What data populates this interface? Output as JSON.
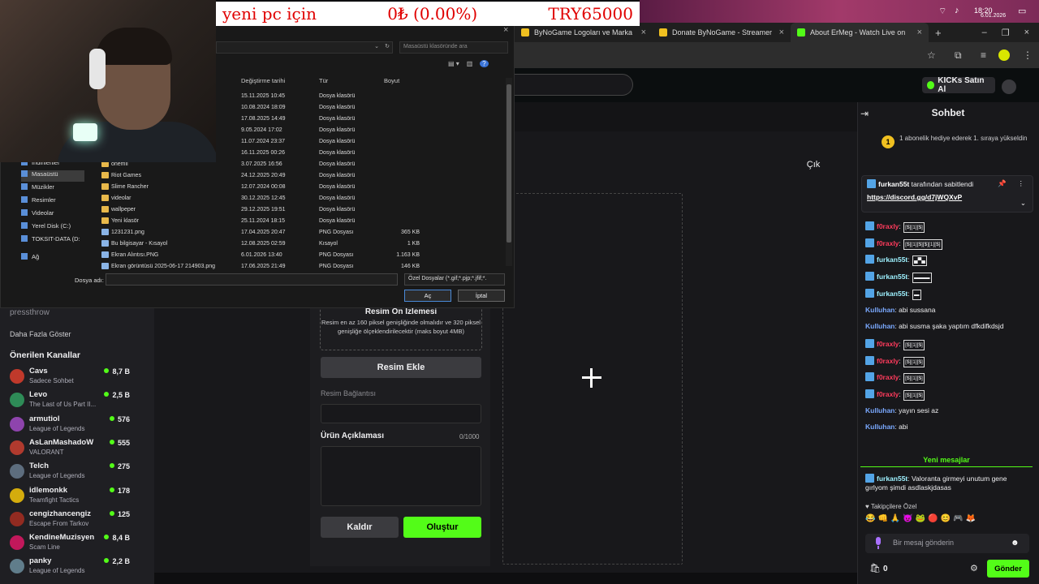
{
  "donation": {
    "left": "yeni pc için",
    "middle": "0₺ (0.00%)",
    "right": "TRY65000"
  },
  "system_tray": {
    "time": "18:20",
    "date": "6.01.2026"
  },
  "browser": {
    "tabs": [
      {
        "label": "ByNoGame Logoları ve Marka",
        "fav_color": "#f0c020"
      },
      {
        "label": "Donate ByNoGame - Streamer",
        "fav_color": "#f0c020"
      },
      {
        "label": "About ErMeg - Watch Live on",
        "fav_color": "#53fc18"
      }
    ]
  },
  "site": {
    "kicks_label": "KICKs Satın Al",
    "exit_label": "Çık"
  },
  "form": {
    "preview_title": "Resim Ön İzlemesi",
    "preview_desc": "Resim en az 160 piksel genişliğinde olmalıdır ve 320 piksel genişliğe ölçeklendirilecektir (maks boyut 4MB)",
    "add_image": "Resim Ekle",
    "link_label": "Resim Bağlantısı",
    "desc_label": "Ürün Açıklaması",
    "desc_count": "0/1000",
    "remove": "Kaldır",
    "create": "Oluştur"
  },
  "sidebar": {
    "partial_channel": "pressthrow",
    "show_more": "Daha Fazla Göster",
    "recommended_title": "Önerilen Kanallar",
    "channels": [
      {
        "name": "Cavs",
        "game": "Sadece Sohbet",
        "viewers": "8,7 B",
        "color": "#c0392b"
      },
      {
        "name": "Levo",
        "game": "The Last of Us Part II...",
        "viewers": "2,5 B",
        "color": "#2e8b57"
      },
      {
        "name": "armutiol",
        "game": "League of Legends",
        "viewers": "576",
        "color": "#8e44ad"
      },
      {
        "name": "AsLanMashadoW",
        "game": "VALORANT",
        "viewers": "555",
        "color": "#b03a2e"
      },
      {
        "name": "Telch",
        "game": "League of Legends",
        "viewers": "275",
        "color": "#5d6d7e"
      },
      {
        "name": "idlemonkk",
        "game": "Teamfight Tactics",
        "viewers": "178",
        "color": "#d4ac0d"
      },
      {
        "name": "cengizhancengiz",
        "game": "Escape From Tarkov",
        "viewers": "125",
        "color": "#922b21"
      },
      {
        "name": "KendineMuzisyen",
        "game": "Scam Line",
        "viewers": "8,4 B",
        "color": "#c2185b"
      },
      {
        "name": "panky",
        "game": "League of Legends",
        "viewers": "2,2 B",
        "color": "#607d8b"
      }
    ]
  },
  "chat": {
    "title": "Sohbet",
    "sub_badge": "1",
    "sub_text": "1 abonelik hediye ederek 1. sıraya yükseldin",
    "pinned_by": "furkan55t",
    "pinned_suffix": " tarafından sabitlendi",
    "pinned_link": "https://discord.gg/d7jWQXvP",
    "messages": [
      {
        "user": "f0raxly",
        "text": "",
        "emotes": "[$][1][$]",
        "color": "#ff3b5c"
      },
      {
        "user": "f0raxly",
        "text": "",
        "emotes": "[$][1][$][$][1][$]",
        "color": "#ff3b5c"
      },
      {
        "user": "furkan55t",
        "text": "",
        "emotes": "▄▀▄",
        "color": "#9ef1ff"
      },
      {
        "user": "furkan55t",
        "text": "",
        "emotes": "▬▬▬",
        "color": "#9ef1ff"
      },
      {
        "user": "furkan55t",
        "text": "",
        "emotes": "▬",
        "color": "#9ef1ff"
      },
      {
        "user": "Kulluhan",
        "text": "abi sussana",
        "emotes": "",
        "color": "#7aa9ff"
      },
      {
        "user": "Kulluhan",
        "text": "abi susma şaka yaptım dfkdifkdsjd",
        "emotes": "",
        "color": "#7aa9ff"
      },
      {
        "user": "f0raxly",
        "text": "",
        "emotes": "[$][1][$]",
        "color": "#ff3b5c"
      },
      {
        "user": "f0raxly",
        "text": "",
        "emotes": "[$][1][$]",
        "color": "#ff3b5c"
      },
      {
        "user": "f0raxly",
        "text": "",
        "emotes": "[$][1][$]",
        "color": "#ff3b5c"
      },
      {
        "user": "f0raxly",
        "text": "",
        "emotes": "[$][1][$]",
        "color": "#ff3b5c"
      },
      {
        "user": "Kulluhan",
        "text": "yayın sesi az",
        "emotes": "",
        "color": "#7aa9ff"
      },
      {
        "user": "Kulluhan",
        "text": "abi",
        "emotes": "",
        "color": "#7aa9ff"
      }
    ],
    "new_messages": "Yeni mesajlar",
    "last_message": {
      "user": "furkan55t",
      "text": "Valoranta girmeyi unutum gene gırlyom şimdi asdlaskjdasas",
      "color": "#9ef1ff"
    },
    "followers_only": "Takipçilere Özel",
    "input_placeholder": "Bir mesaj gönderin",
    "points": "0",
    "send": "Gönder"
  },
  "dialog": {
    "search_placeholder": "Masaüstü klasöründe ara",
    "columns": {
      "date": "Değiştirme tarihi",
      "type": "Tür",
      "size": "Boyut"
    },
    "nav": [
      {
        "label": "İndirilenler",
        "selected": false
      },
      {
        "label": "Masaüstü",
        "selected": true
      },
      {
        "label": "Müzikler",
        "selected": false
      },
      {
        "label": "Resimler",
        "selected": false
      },
      {
        "label": "Videolar",
        "selected": false
      },
      {
        "label": "Yerel Disk (C:)",
        "selected": false
      },
      {
        "label": "TOKSIT-DATA (D:",
        "selected": false
      },
      {
        "label": "Ağ",
        "selected": false
      }
    ],
    "files": [
      {
        "name": "",
        "date": "15.11.2025 10:45",
        "type": "Dosya klasörü",
        "size": "",
        "folder": true
      },
      {
        "name": "",
        "date": "10.08.2024 18:09",
        "type": "Dosya klasörü",
        "size": "",
        "folder": true
      },
      {
        "name": "",
        "date": "17.08.2025 14:49",
        "type": "Dosya klasörü",
        "size": "",
        "folder": true
      },
      {
        "name": "",
        "date": "9.05.2024 17:02",
        "type": "Dosya klasörü",
        "size": "",
        "folder": true
      },
      {
        "name": "",
        "date": "11.07.2024 23:37",
        "type": "Dosya klasörü",
        "size": "",
        "folder": true
      },
      {
        "name": "",
        "date": "16.11.2025 00:26",
        "type": "Dosya klasörü",
        "size": "",
        "folder": true
      },
      {
        "name": "önemli",
        "date": "3.07.2025 16:56",
        "type": "Dosya klasörü",
        "size": "",
        "folder": true
      },
      {
        "name": "Riot Games",
        "date": "24.12.2025 20:49",
        "type": "Dosya klasörü",
        "size": "",
        "folder": true
      },
      {
        "name": "Slime Rancher",
        "date": "12.07.2024 00:08",
        "type": "Dosya klasörü",
        "size": "",
        "folder": true
      },
      {
        "name": "videolar",
        "date": "30.12.2025 12:45",
        "type": "Dosya klasörü",
        "size": "",
        "folder": true
      },
      {
        "name": "wallpeper",
        "date": "29.12.2025 19:51",
        "type": "Dosya klasörü",
        "size": "",
        "folder": true
      },
      {
        "name": "Yeni klasör",
        "date": "25.11.2024 18:15",
        "type": "Dosya klasörü",
        "size": "",
        "folder": true
      },
      {
        "name": "1231231.png",
        "date": "17.04.2025 20:47",
        "type": "PNG Dosyası",
        "size": "365 KB",
        "folder": false
      },
      {
        "name": "Bu bilgisayar - Kısayol",
        "date": "12.08.2025 02:59",
        "type": "Kısayol",
        "size": "1 KB",
        "folder": false
      },
      {
        "name": "Ekran Alıntısı.PNG",
        "date": "6.01.2026 13:40",
        "type": "PNG Dosyası",
        "size": "1.163 KB",
        "folder": false
      },
      {
        "name": "Ekran görüntüsü 2025-06-17 214903.png",
        "date": "17.06.2025 21:49",
        "type": "PNG Dosyası",
        "size": "146 KB",
        "folder": false
      }
    ],
    "filename_label": "Dosya adı:",
    "filetype": "Özel Dosyalar (*.gif;*.pjp;*.jfif;*.",
    "open": "Aç",
    "cancel": "İptal"
  }
}
